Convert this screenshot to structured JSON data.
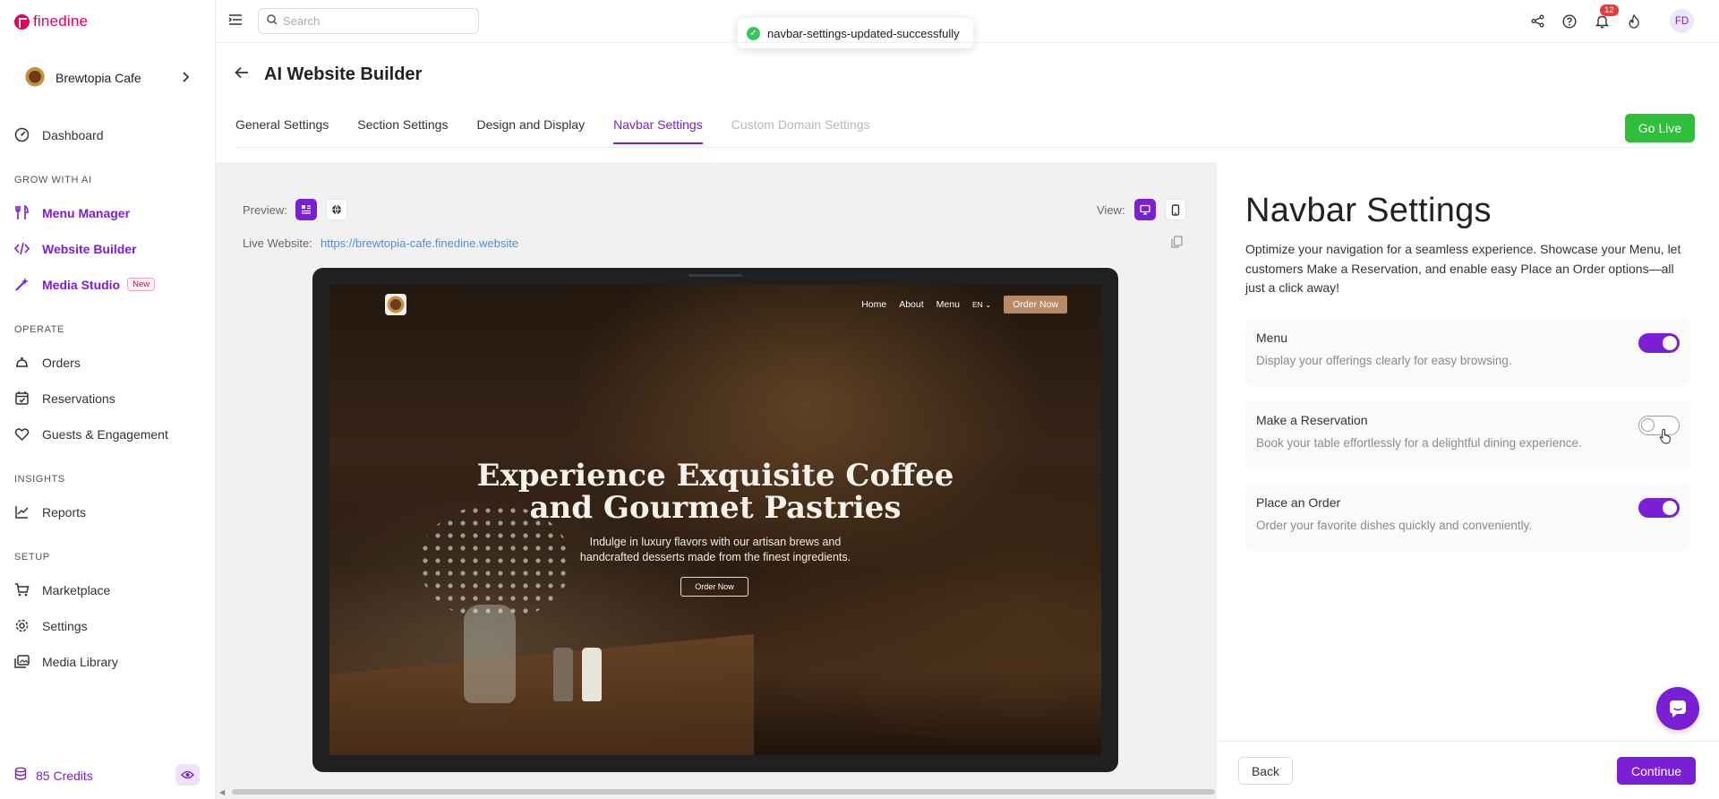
{
  "app": {
    "brand_name": "finedine",
    "accent": "#7a1fd6",
    "brand_color": "#e4005b"
  },
  "business": {
    "name": "Brewtopia Cafe"
  },
  "sidebar": {
    "items": [
      {
        "label": "Dashboard",
        "icon": "dashboard-icon"
      },
      {
        "label": "Menu Manager",
        "icon": "utensils-icon"
      },
      {
        "label": "Website Builder",
        "icon": "code-icon"
      },
      {
        "label": "Media Studio",
        "icon": "magic-wand-icon",
        "badge": "New"
      },
      {
        "label": "Orders",
        "icon": "orders-icon"
      },
      {
        "label": "Reservations",
        "icon": "calendar-check-icon"
      },
      {
        "label": "Guests & Engagement",
        "icon": "heart-icon"
      },
      {
        "label": "Reports",
        "icon": "chart-line-icon"
      },
      {
        "label": "Marketplace",
        "icon": "cart-icon"
      },
      {
        "label": "Settings",
        "icon": "gear-icon"
      },
      {
        "label": "Media Library",
        "icon": "images-icon"
      }
    ],
    "sections": {
      "grow": "GROW WITH AI",
      "operate": "OPERATE",
      "insights": "INSIGHTS",
      "setup": "SETUP"
    },
    "credits": "85 Credits"
  },
  "topbar": {
    "search_placeholder": "Search",
    "toast": "navbar-settings-updated-successfully",
    "notification_count": "12",
    "user_initials": "FD"
  },
  "page": {
    "title": "AI Website Builder",
    "tabs": [
      {
        "label": "General Settings"
      },
      {
        "label": "Section Settings"
      },
      {
        "label": "Design and Display"
      },
      {
        "label": "Navbar Settings"
      },
      {
        "label": "Custom Domain Settings"
      }
    ],
    "go_live": "Go Live"
  },
  "preview": {
    "preview_label": "Preview:",
    "view_label": "View:",
    "live_label": "Live Website:",
    "live_url": "https://brewtopia-cafe.finedine.website",
    "site": {
      "nav": [
        "Home",
        "About",
        "Menu"
      ],
      "lang": "EN ⌄",
      "order_button": "Order Now",
      "hero_title": "Experience Exquisite Coffee and Gourmet Pastries",
      "hero_subtitle": "Indulge in luxury flavors with our artisan brews and handcrafted desserts made from the finest ingredients.",
      "hero_button": "Order Now"
    }
  },
  "navbar_settings": {
    "title": "Navbar Settings",
    "description": "Optimize your navigation for a seamless experience. Showcase your Menu, let customers Make a Reservation, and enable easy Place an Order options—all just a click away!",
    "options": [
      {
        "name": "Menu",
        "desc": "Display your offerings clearly for easy browsing.",
        "enabled": true
      },
      {
        "name": "Make a Reservation",
        "desc": "Book your table effortlessly for a delightful dining experience.",
        "enabled": false
      },
      {
        "name": "Place an Order",
        "desc": "Order your favorite dishes quickly and conveniently.",
        "enabled": true
      }
    ]
  },
  "footer": {
    "back": "Back",
    "continue": "Continue"
  }
}
